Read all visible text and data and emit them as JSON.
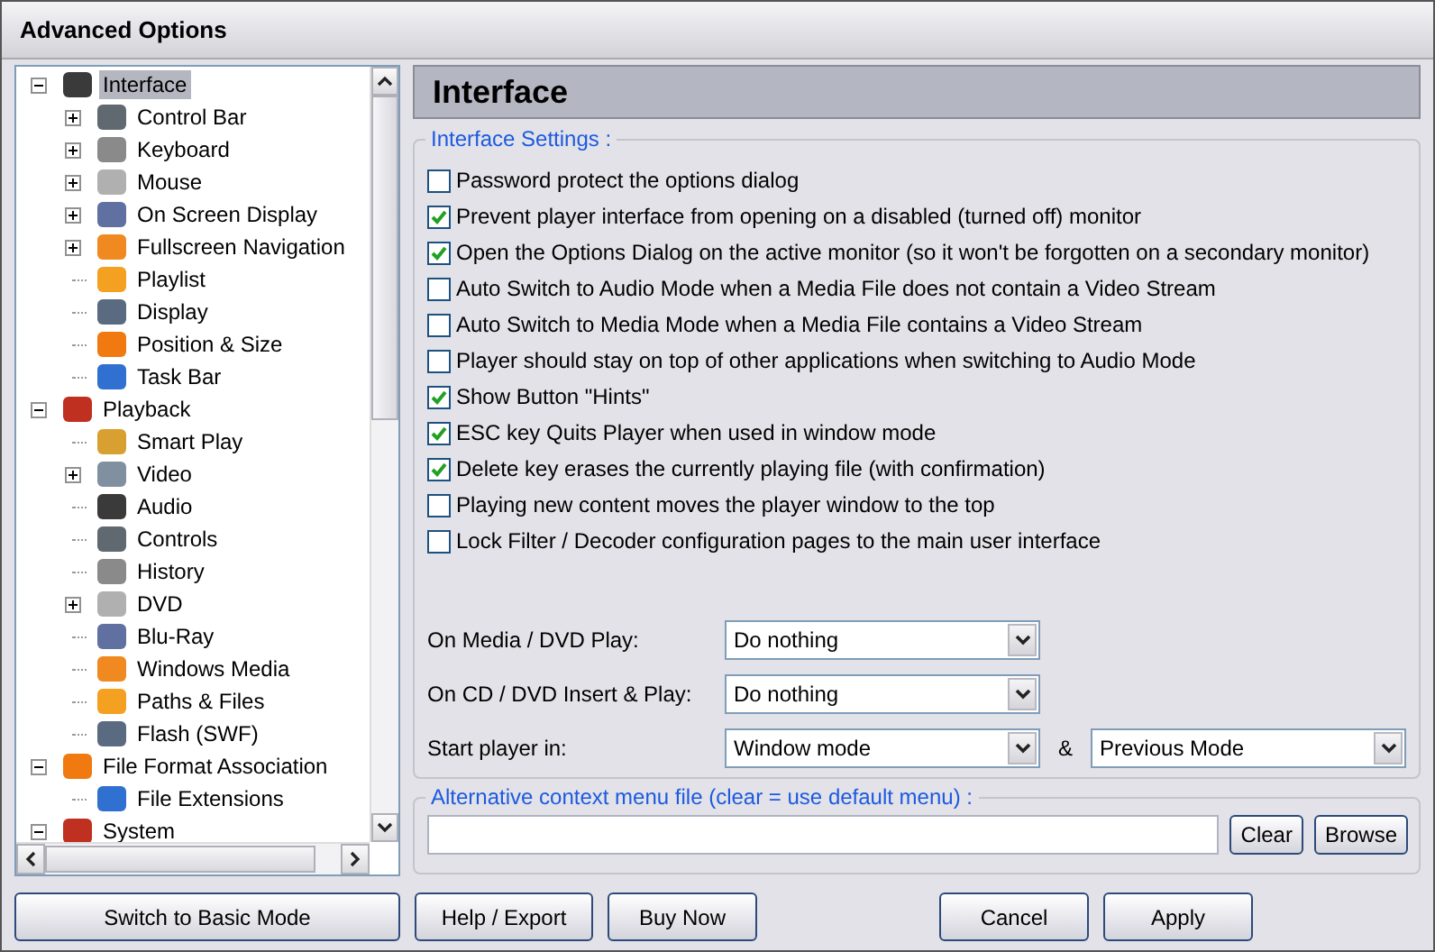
{
  "window": {
    "title": "Advanced Options"
  },
  "tree": [
    {
      "label": "Interface",
      "selected": true,
      "expanded": true,
      "children": [
        {
          "label": "Control Bar",
          "selected": false,
          "expanded": false
        },
        {
          "label": "Keyboard",
          "selected": false,
          "expanded": false
        },
        {
          "label": "Mouse",
          "selected": false,
          "expanded": false
        },
        {
          "label": "On Screen Display",
          "selected": false,
          "expanded": false
        },
        {
          "label": "Fullscreen Navigation",
          "selected": false,
          "expanded": false
        },
        {
          "label": "Playlist",
          "selected": false
        },
        {
          "label": "Display",
          "selected": false
        },
        {
          "label": "Position & Size",
          "selected": false
        },
        {
          "label": "Task Bar",
          "selected": false
        }
      ]
    },
    {
      "label": "Playback",
      "selected": false,
      "expanded": true,
      "children": [
        {
          "label": "Smart Play",
          "selected": false
        },
        {
          "label": "Video",
          "selected": false,
          "expanded": false
        },
        {
          "label": "Audio",
          "selected": false
        },
        {
          "label": "Controls",
          "selected": false
        },
        {
          "label": "History",
          "selected": false
        },
        {
          "label": "DVD",
          "selected": false,
          "expanded": false
        },
        {
          "label": "Blu-Ray",
          "selected": false
        },
        {
          "label": "Windows Media",
          "selected": false
        },
        {
          "label": "Paths & Files",
          "selected": false
        },
        {
          "label": "Flash (SWF)",
          "selected": false
        }
      ]
    },
    {
      "label": "File Format Association",
      "selected": false,
      "expanded": true,
      "children": [
        {
          "label": "File Extensions",
          "selected": false
        }
      ]
    },
    {
      "label": "System",
      "selected": false,
      "expanded": true
    }
  ],
  "page_title": "Interface",
  "settings": {
    "title": "Interface Settings :",
    "options": [
      {
        "label": "Password protect the options dialog",
        "checked": false
      },
      {
        "label": "Prevent player interface from opening on a disabled (turned off) monitor",
        "checked": true
      },
      {
        "label": "Open the Options Dialog on the active monitor (so it won't be forgotten on a secondary monitor)",
        "checked": true
      },
      {
        "label": "Auto Switch to Audio Mode when a Media File does not contain a Video Stream",
        "checked": false
      },
      {
        "label": "Auto Switch to Media Mode when a Media File contains a Video Stream",
        "checked": false
      },
      {
        "label": "Player should stay on top of other applications when switching to Audio Mode",
        "checked": false
      },
      {
        "label": "Show Button \"Hints\"",
        "checked": true
      },
      {
        "label": "ESC key Quits Player when used in window mode",
        "checked": true
      },
      {
        "label": "Delete key erases the currently playing file (with confirmation)",
        "checked": true
      },
      {
        "label": "Playing new content moves the player window to the top",
        "checked": false
      },
      {
        "label": "Lock Filter / Decoder configuration pages to the main user interface",
        "checked": false
      }
    ],
    "dropdowns": [
      {
        "label": "On Media / DVD Play:",
        "values": [
          "Do nothing"
        ]
      },
      {
        "label": "On CD / DVD Insert & Play:",
        "values": [
          "Do nothing"
        ]
      },
      {
        "label": "Start player in:",
        "values": [
          "Window mode",
          "Previous Mode"
        ],
        "joiner": "&"
      }
    ]
  },
  "context_menu_file": {
    "title": "Alternative context menu file (clear = use default menu) :",
    "buttons": [
      "Clear",
      "Browse"
    ]
  },
  "footer": {
    "left": [
      "Switch to Basic Mode",
      "Help / Export",
      "Buy Now"
    ],
    "right": [
      "Cancel",
      "Apply"
    ]
  }
}
